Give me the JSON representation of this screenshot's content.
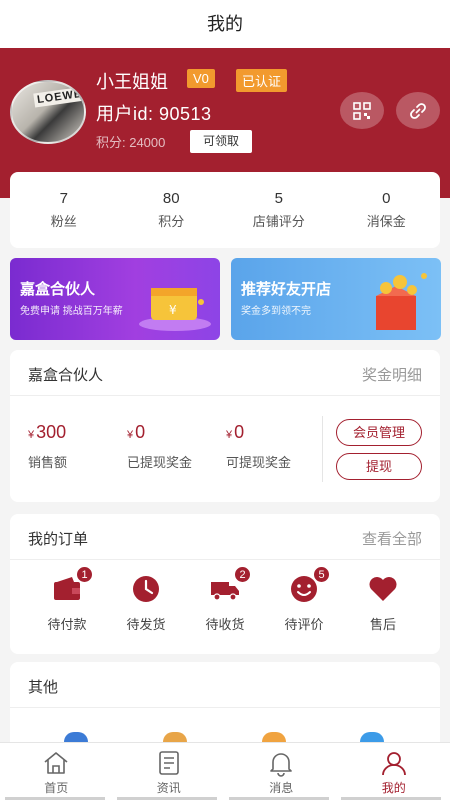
{
  "page": {
    "title": "我的"
  },
  "profile": {
    "name": "小王姐姐",
    "level": "V0",
    "verified": "已认证",
    "user_id": "用户id: 90513",
    "points_text": "积分: 24000",
    "claim_label": "可领取",
    "avatar_text": "LOEWE"
  },
  "stats": [
    {
      "value": "7",
      "label": "粉丝"
    },
    {
      "value": "80",
      "label": "积分"
    },
    {
      "value": "5",
      "label": "店铺评分"
    },
    {
      "value": "0",
      "label": "消保金"
    }
  ],
  "banners": [
    {
      "title": "嘉盒合伙人",
      "subtitle": "免费申请 挑战百万年薪"
    },
    {
      "title": "推荐好友开店",
      "subtitle": "奖金多到领不完"
    }
  ],
  "partner": {
    "title": "嘉盒合伙人",
    "detail_link": "奖金明细",
    "currency": "¥",
    "amounts": [
      {
        "value": "300",
        "label": "销售额"
      },
      {
        "value": "0",
        "label": "已提现奖金"
      },
      {
        "value": "0",
        "label": "可提现奖金"
      }
    ],
    "member_btn": "会员管理",
    "withdraw_btn": "提现"
  },
  "orders": {
    "title": "我的订单",
    "view_all": "查看全部",
    "items": [
      {
        "label": "待付款",
        "count": "1",
        "icon": "wallet-icon"
      },
      {
        "label": "待发货",
        "count": "",
        "icon": "clock-icon"
      },
      {
        "label": "待收货",
        "count": "2",
        "icon": "truck-icon"
      },
      {
        "label": "待评价",
        "count": "5",
        "icon": "smile-icon"
      },
      {
        "label": "售后",
        "count": "",
        "icon": "heart-icon"
      }
    ]
  },
  "other": {
    "title": "其他"
  },
  "tabs": [
    {
      "label": "首页",
      "icon": "home-icon"
    },
    {
      "label": "资讯",
      "icon": "news-icon"
    },
    {
      "label": "消息",
      "icon": "bell-icon"
    },
    {
      "label": "我的",
      "icon": "user-icon"
    }
  ],
  "colors": {
    "brand": "#a3202f",
    "badge": "#f29a2e"
  }
}
